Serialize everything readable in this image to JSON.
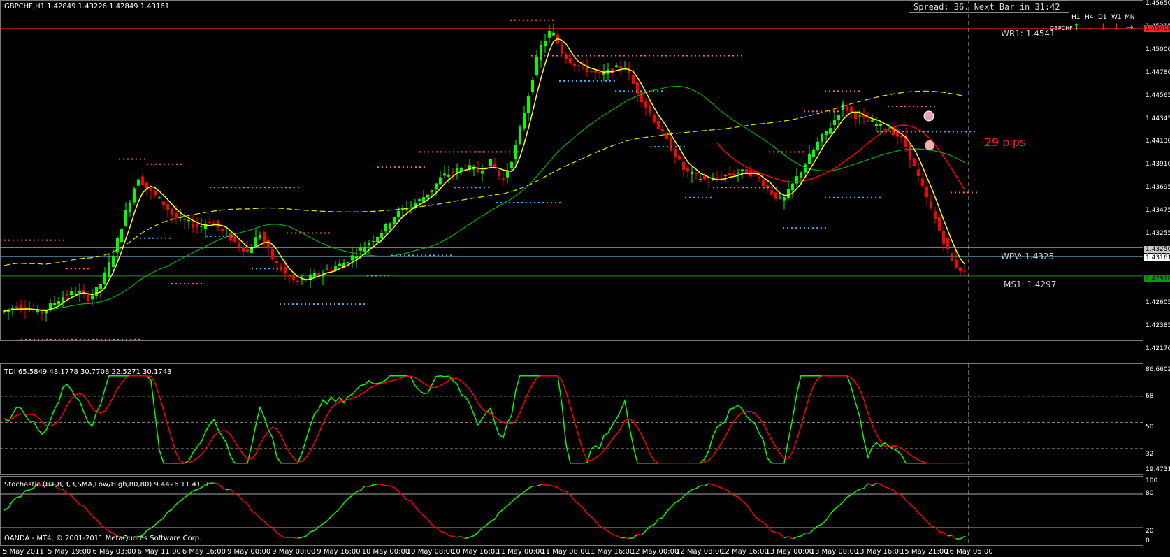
{
  "colors": {
    "bull": "#00ff00",
    "bear": "#ff0000",
    "ma_fast": "#ffff00",
    "ma_mid": "#ff0000",
    "ma_slow": "#00b000",
    "ma_long": "#e6e600",
    "res_dots": "#ff6060",
    "sup_dots": "#3cb4ff",
    "wr1": "#ff2020",
    "wpv": "#5a8fa8",
    "ms1": "#00a000",
    "tdi_green": "#00ff00",
    "tdi_red": "#ff0000"
  },
  "header": {
    "symbol_info": "GBPCHF,H1  1.42849 1.43226 1.42849 1.43161"
  },
  "spread_box": {
    "text": "Spread: 36. Next Bar in 31:42"
  },
  "timeframes": {
    "labels": [
      "H1",
      "H4",
      "D1",
      "W1",
      "MN"
    ],
    "pair": "GBPCHF",
    "arrows": [
      "up",
      "down",
      "down",
      "down",
      "right"
    ]
  },
  "levels": {
    "wr1": "WR1: 1.4541",
    "wpv": "WPV: 1.4325",
    "ms1": "MS1: 1.4297"
  },
  "annotation": {
    "pips": "-29 pips"
  },
  "price_axis": {
    "ticks": [
      "1.45650",
      "1.45215",
      "1.45000",
      "1.44780",
      "1.44565",
      "1.44345",
      "1.44130",
      "1.43910",
      "1.43695",
      "1.43475",
      "1.43255",
      "1.43040",
      "1.42820",
      "1.42605",
      "1.42385",
      "1.42170"
    ],
    "tags": [
      {
        "text": "1.45409",
        "color": "#ff2020"
      },
      {
        "text": "1.43250",
        "color": "#c8c8c8"
      },
      {
        "text": "1.43161",
        "color": "#ffffff"
      },
      {
        "text": "1.42970",
        "color": "#00a000"
      }
    ]
  },
  "tdi": {
    "label": "TDI 65.5849 48.1778 30.7708 22.5271 30.1743",
    "axis": [
      "86.6602",
      "68",
      "50",
      "32",
      "19.4731"
    ]
  },
  "stoch": {
    "label": "Stochastic (H1,8,3,3,SMA,Low/High,80,80) 9.4426 11.4111",
    "axis": [
      "100",
      "80",
      "20",
      "0"
    ]
  },
  "copyright": "OANDA - MT4, © 2001-2011 MetaQuotes Software Corp.",
  "time_axis": [
    "5 May 2011",
    "5 May 19:00",
    "6 May 03:00",
    "6 May 11:00",
    "6 May 16:00",
    "9 May 00:00",
    "9 May 08:00",
    "9 May 16:00",
    "10 May 00:00",
    "10 May 08:00",
    "10 May 16:00",
    "11 May 00:00",
    "11 May 08:00",
    "11 May 16:00",
    "12 May 00:00",
    "12 May 08:00",
    "12 May 16:00",
    "13 May 00:00",
    "13 May 08:00",
    "13 May 16:00",
    "15 May 21:00",
    "16 May 05:00"
  ],
  "chart_data": {
    "type": "candlestick",
    "symbol": "GBPCHF",
    "timeframe": "H1",
    "ylim": [
      1.4217,
      1.4565
    ],
    "trend": [
      1.4262,
      1.4268,
      1.4265,
      1.426,
      1.427,
      1.4278,
      1.4282,
      1.4275,
      1.429,
      1.432,
      1.436,
      1.4395,
      1.438,
      1.437,
      1.4355,
      1.435,
      1.4345,
      1.4352,
      1.434,
      1.433,
      1.432,
      1.434,
      1.4315,
      1.43,
      1.429,
      1.4295,
      1.43,
      1.4305,
      1.431,
      1.432,
      1.433,
      1.434,
      1.4355,
      1.4365,
      1.437,
      1.438,
      1.4395,
      1.44,
      1.4405,
      1.44,
      1.441,
      1.439,
      1.442,
      1.447,
      1.452,
      1.454,
      1.4515,
      1.4505,
      1.45,
      1.4495,
      1.45,
      1.4505,
      1.448,
      1.446,
      1.444,
      1.442,
      1.44,
      1.4395,
      1.439,
      1.4395,
      1.4398,
      1.44,
      1.4395,
      1.438,
      1.437,
      1.439,
      1.441,
      1.443,
      1.4445,
      1.4465,
      1.4455,
      1.445,
      1.4445,
      1.444,
      1.443,
      1.44,
      1.437,
      1.434,
      1.431,
      1.43
    ]
  }
}
